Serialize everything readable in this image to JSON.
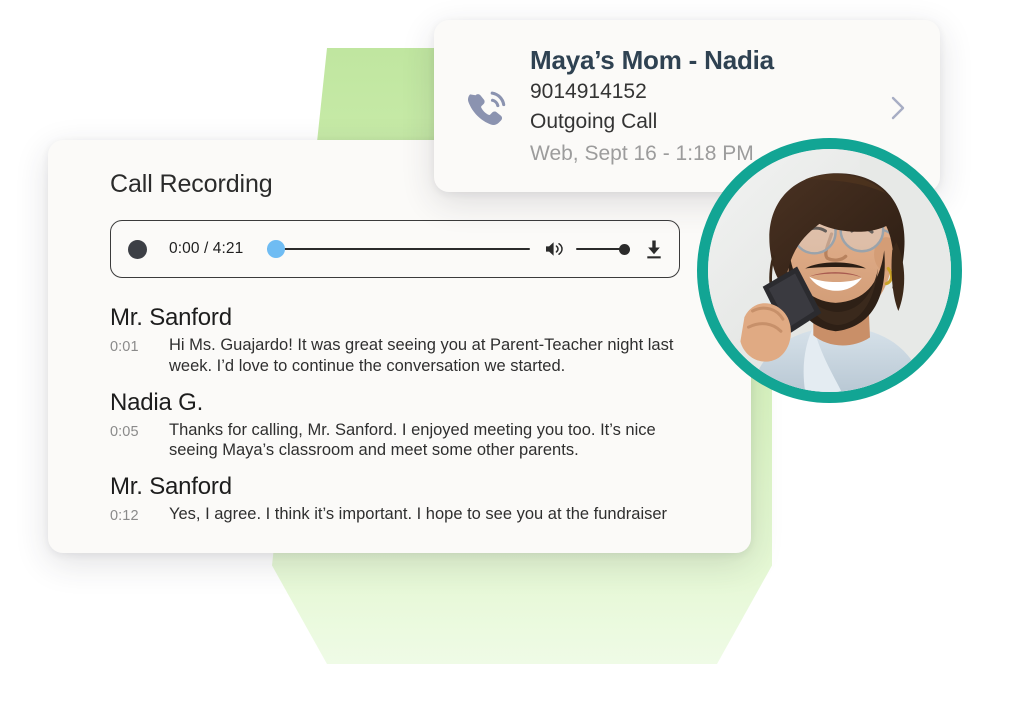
{
  "call_card": {
    "icon": "phone-outgoing-icon",
    "title": "Maya’s Mom - Nadia",
    "phone_number": "9014914152",
    "call_type": "Outgoing Call",
    "meta": "Web, Sept 16 - 1:18 PM",
    "chevron": "chevron-right-icon"
  },
  "recording": {
    "heading": "Call Recording",
    "player": {
      "play_icon": "play-record-icon",
      "time_display": "0:00 / 4:21",
      "current_time": "0:00",
      "duration": "4:21",
      "seek_percent": 0,
      "volume_icon": "volume-high-icon",
      "volume_percent": 100,
      "download_icon": "download-icon"
    }
  },
  "transcript": [
    {
      "speaker": "Mr. Sanford",
      "time": "0:01",
      "text": "Hi Ms. Guajardo! It was great seeing you at Parent-Teacher night last week. I’d love to continue the conversation we started."
    },
    {
      "speaker": "Nadia G.",
      "time": "0:05",
      "text": "Thanks for calling, Mr. Sanford. I enjoyed meeting you too. It’s nice seeing Maya’s classroom and meet some other parents."
    },
    {
      "speaker": "Mr. Sanford",
      "time": "0:12",
      "text": "Yes, I agree. I think it’s important. I hope to see you at the fundraiser"
    }
  ],
  "avatar": {
    "label": "caller-photo",
    "ring_color": "#12a594"
  },
  "colors": {
    "accent_teal": "#12a594",
    "backdrop_green": "#c9ecab",
    "seek_thumb_blue": "#6fbcf3",
    "title_navy": "#2f4252",
    "phone_icon_slate": "#8b93b0"
  }
}
